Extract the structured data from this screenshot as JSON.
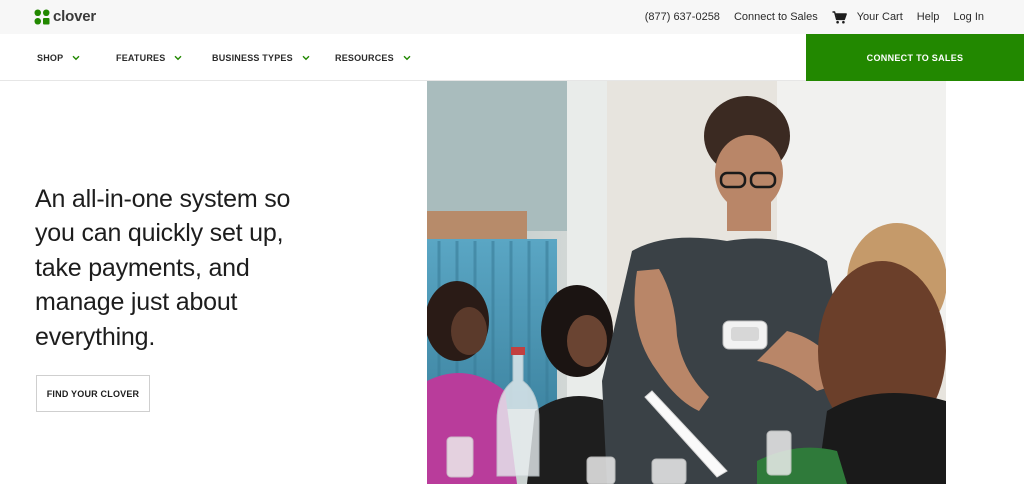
{
  "brand": {
    "name": "clover",
    "color": "#228800"
  },
  "topbar": {
    "phone": "(877) 637-0258",
    "connect": "Connect to Sales",
    "cart": "Your Cart",
    "help": "Help",
    "login": "Log In"
  },
  "nav": {
    "items": [
      {
        "label": "SHOP"
      },
      {
        "label": "FEATURES"
      },
      {
        "label": "BUSINESS TYPES"
      },
      {
        "label": "RESOURCES"
      }
    ],
    "cta": "CONNECT TO SALES"
  },
  "hero": {
    "headline": "An all-in-one system so you can quickly set up, take payments, and manage just about everything.",
    "button": "FIND YOUR CLOVER"
  },
  "icons": {
    "logo": "clover-leaf-icon",
    "cart": "shopping-cart-icon",
    "nav_chevron": "chevron-down-icon"
  }
}
